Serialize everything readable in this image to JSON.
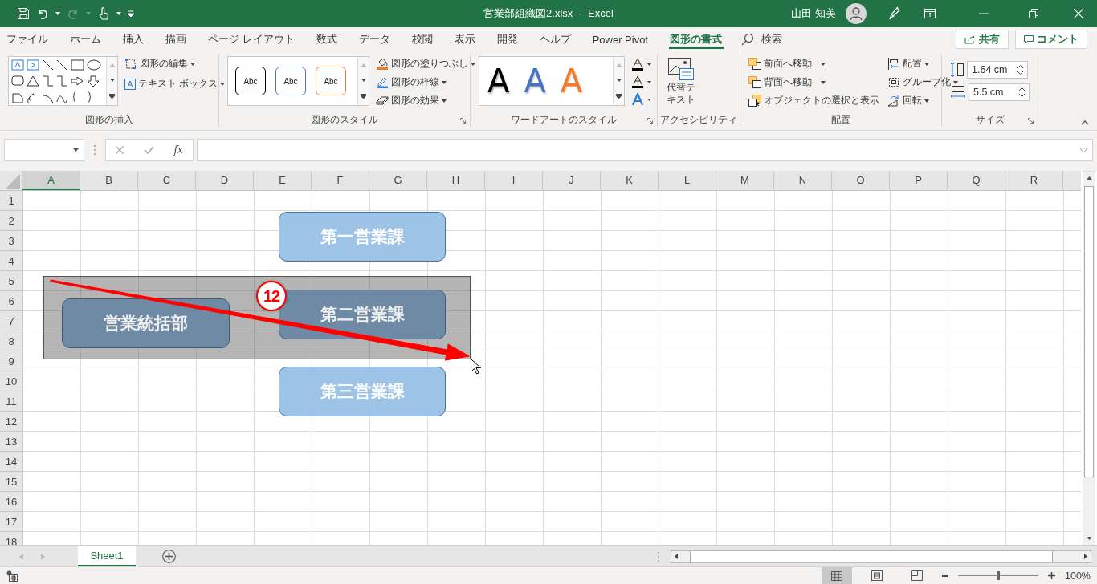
{
  "title_bar": {
    "title": "営業部組織図2.xlsx  -  Excel",
    "user": "山田 知美"
  },
  "menu_tabs": [
    {
      "label": "ファイル",
      "selected": false
    },
    {
      "label": "ホーム",
      "selected": false
    },
    {
      "label": "挿入",
      "selected": false
    },
    {
      "label": "描画",
      "selected": false
    },
    {
      "label": "ページ レイアウト",
      "selected": false
    },
    {
      "label": "数式",
      "selected": false
    },
    {
      "label": "データ",
      "selected": false
    },
    {
      "label": "校閲",
      "selected": false
    },
    {
      "label": "表示",
      "selected": false
    },
    {
      "label": "開発",
      "selected": false
    },
    {
      "label": "ヘルプ",
      "selected": false
    },
    {
      "label": "Power Pivot",
      "selected": false
    },
    {
      "label": "図形の書式",
      "selected": true
    }
  ],
  "search": {
    "label": "検索"
  },
  "share_button": "共有",
  "comment_button": "コメント",
  "ribbon": {
    "insert_shapes": {
      "commands": [
        "図形の編集",
        "テキスト ボックス"
      ],
      "label": "図形の挿入"
    },
    "shape_styles": {
      "presets": [
        {
          "text": "Abc",
          "color": "#000000"
        },
        {
          "text": "Abc",
          "color": "#4472c4"
        },
        {
          "text": "Abc",
          "color": "#ed7d31"
        }
      ],
      "commands": [
        "図形の塗りつぶし",
        "図形の枠線",
        "図形の効果"
      ],
      "label": "図形のスタイル"
    },
    "wordart": {
      "letters": [
        {
          "text": "A",
          "color": "#000000"
        },
        {
          "text": "A",
          "color": "#4472c4"
        },
        {
          "text": "A",
          "color": "#ed7d31"
        }
      ],
      "label": "ワードアートのスタイル"
    },
    "accessibility": {
      "command": "代替テキスト",
      "label": "アクセシビリティ"
    },
    "arrange": {
      "commands": [
        "前面へ移動",
        "背面へ移動",
        "オブジェクトの選択と表示"
      ],
      "commands_right": [
        "配置",
        "グループ化",
        "回転"
      ],
      "label": "配置"
    },
    "size": {
      "height": "1.64 cm",
      "width": "5.5 cm",
      "label": "サイズ"
    }
  },
  "formula_bar": {
    "fx": "fx"
  },
  "columns": [
    {
      "label": "A",
      "selected": true
    },
    {
      "label": "B",
      "selected": false
    },
    {
      "label": "C",
      "selected": false
    },
    {
      "label": "D",
      "selected": false
    },
    {
      "label": "E",
      "selected": false
    },
    {
      "label": "F",
      "selected": false
    },
    {
      "label": "G",
      "selected": false
    },
    {
      "label": "H",
      "selected": false
    },
    {
      "label": "I",
      "selected": false
    },
    {
      "label": "J",
      "selected": false
    },
    {
      "label": "K",
      "selected": false
    },
    {
      "label": "L",
      "selected": false
    },
    {
      "label": "M",
      "selected": false
    },
    {
      "label": "N",
      "selected": false
    },
    {
      "label": "O",
      "selected": false
    },
    {
      "label": "P",
      "selected": false
    },
    {
      "label": "Q",
      "selected": false
    },
    {
      "label": "R",
      "selected": false
    }
  ],
  "rows": [
    "1",
    "2",
    "3",
    "4",
    "5",
    "6",
    "7",
    "8",
    "9",
    "10",
    "11",
    "12",
    "13",
    "14",
    "15",
    "16",
    "17",
    "18"
  ],
  "shapes": [
    {
      "text": "第一営業課",
      "in_selection": false
    },
    {
      "text": "営業統括部",
      "in_selection": true
    },
    {
      "text": "第二営業課",
      "in_selection": true
    },
    {
      "text": "第三営業課",
      "in_selection": false
    }
  ],
  "annotation": {
    "step": "12"
  },
  "sheet_tabs": [
    {
      "label": "Sheet1",
      "selected": true
    }
  ],
  "status_bar": {
    "views": [
      {
        "kind": "normal",
        "selected": true
      },
      {
        "kind": "page_layout",
        "selected": false
      },
      {
        "kind": "page_break",
        "selected": false
      }
    ],
    "zoom_slider": {
      "level": 0.5
    },
    "zoom": "100%"
  }
}
